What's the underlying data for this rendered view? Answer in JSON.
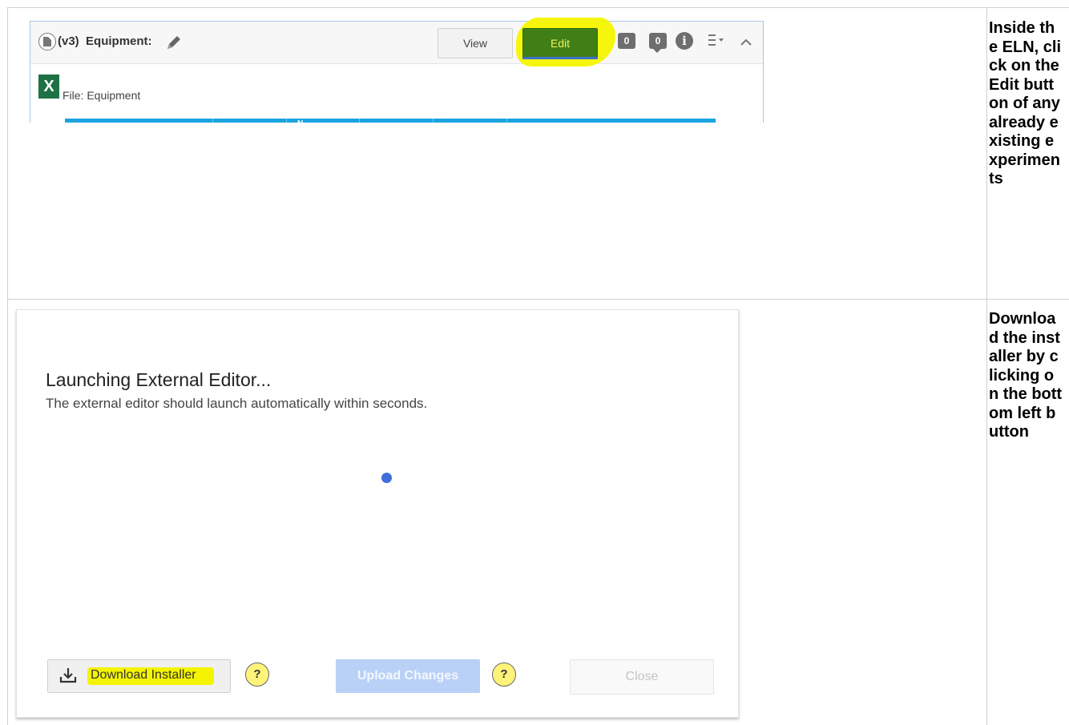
{
  "step1": {
    "panel": {
      "version": "(v3)",
      "title": "Equipment:",
      "view_label": "View",
      "edit_label": "Edit",
      "badge_attachments": "0",
      "badge_comments": "0",
      "info_icon": "i",
      "file_icon_letter": "X",
      "file_label": "File: Equipment",
      "table_header_fragment": "N"
    },
    "instruction": "Inside the ELN, click on the Edit  button of any already existing experiments"
  },
  "step2": {
    "dialog": {
      "title": "Launching External Editor...",
      "message": "The external editor should launch automatically within seconds.",
      "download_label": "Download Installer",
      "help_label": "?",
      "upload_label": "Upload Changes",
      "close_label": "Close"
    },
    "instruction": "Download the installer by clicking on the bottom left button"
  },
  "colors": {
    "edit_button": "#3f7f16",
    "highlight": "#f5f500",
    "excel_green": "#1e7145",
    "table_header": "#1aa4e0",
    "spinner": "#3f6fd8",
    "upload_disabled": "#b9d1f7"
  },
  "icons": [
    "document-icon",
    "pencil-icon",
    "info-icon",
    "menu-icon",
    "collapse-icon",
    "excel-icon",
    "download-icon",
    "help-icon"
  ]
}
